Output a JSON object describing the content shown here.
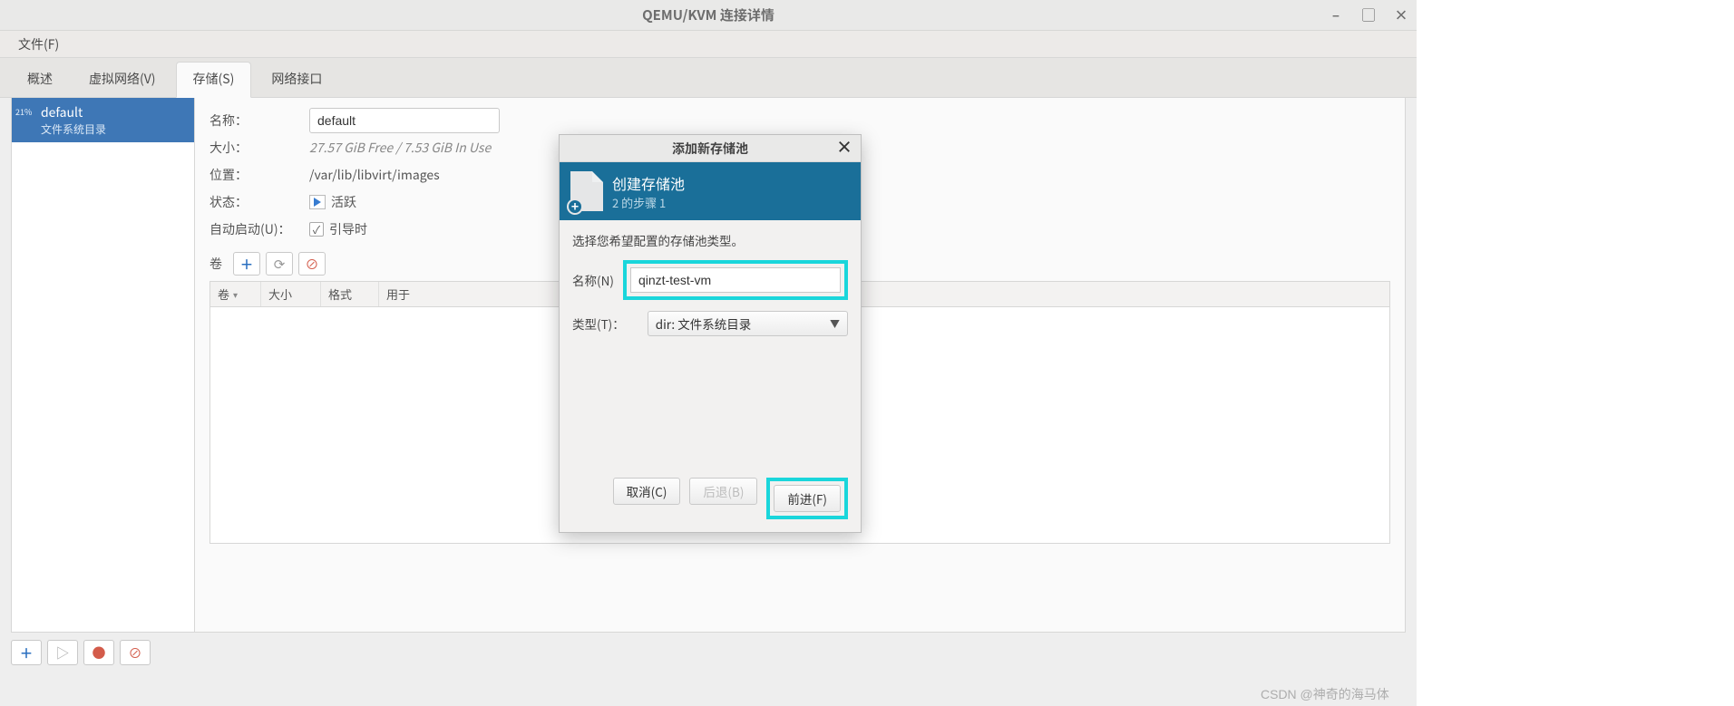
{
  "window": {
    "title": "QEMU/KVM 连接详情"
  },
  "menubar": {
    "file": "文件(F)"
  },
  "tabs": {
    "overview": "概述",
    "virtual_networks": "虚拟网络(V)",
    "storage": "存储(S)",
    "network_interfaces": "网络接口"
  },
  "sidebar": {
    "items": [
      {
        "percentage": "21%",
        "name": "default",
        "subtitle": "文件系统目录"
      }
    ]
  },
  "details": {
    "labels": {
      "name": "名称：",
      "size": "大小：",
      "location": "位置：",
      "state": "状态：",
      "autostart": "自动启动(U)：",
      "volumes": "卷"
    },
    "values": {
      "name": "default",
      "size_free": "27.57 GiB Free",
      "size_sep": " / ",
      "size_used": "7.53 GiB In Use",
      "location": "/var/lib/libvirt/images",
      "state": "活跃",
      "autostart_label": "引导时"
    }
  },
  "vol_table": {
    "columns": {
      "volume": "卷",
      "size": "大小",
      "format": "格式",
      "used_by": "用于"
    }
  },
  "modal": {
    "title": "添加新存储池",
    "banner_title": "创建存储池",
    "banner_step": "2  的步骤 1",
    "prompt": "选择您希望配置的存储池类型。",
    "labels": {
      "name": "名称(N)",
      "type": "类型(T)："
    },
    "fields": {
      "name": "qinzt-test-vm",
      "type": "dir: 文件系统目录"
    },
    "buttons": {
      "cancel": "取消(C)",
      "back": "后退(B)",
      "forward": "前进(F)"
    }
  },
  "watermark": "CSDN @神奇的海马体"
}
